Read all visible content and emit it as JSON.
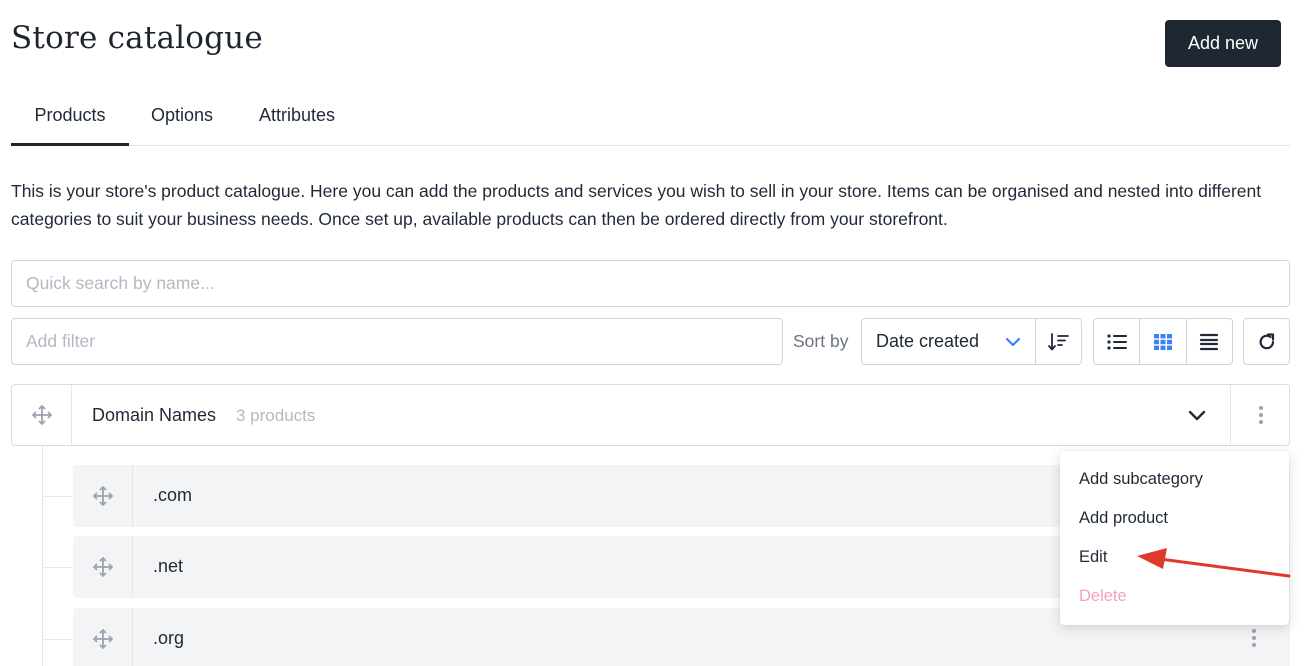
{
  "page": {
    "title": "Store catalogue",
    "add_new_label": "Add new"
  },
  "tabs": [
    {
      "label": "Products",
      "active": true
    },
    {
      "label": "Options",
      "active": false
    },
    {
      "label": "Attributes",
      "active": false
    }
  ],
  "description": "This is your store's product catalogue. Here you can add the products and services you wish to sell in your store. Items can be organised and nested into different categories to suit your business needs. Once set up, available products can then be ordered directly from your storefront.",
  "search": {
    "placeholder": "Quick search by name...",
    "value": ""
  },
  "filter": {
    "placeholder": "Add filter",
    "value": ""
  },
  "sort": {
    "label": "Sort by",
    "value": "Date created"
  },
  "category": {
    "name": "Domain Names",
    "count": "3 products"
  },
  "products": [
    {
      "name": ".com"
    },
    {
      "name": ".net"
    },
    {
      "name": ".org"
    }
  ],
  "context_menu": {
    "items": [
      {
        "label": "Add subcategory"
      },
      {
        "label": "Add product"
      },
      {
        "label": "Edit"
      },
      {
        "label": "Delete",
        "danger": true
      }
    ]
  },
  "colors": {
    "primary": "#1f2733",
    "accent": "#3b82f6",
    "danger": "#f2a5b6",
    "annotation_arrow": "#e0392b"
  },
  "icons": {
    "drag": "move-icon",
    "sort_chevron": "chevron-down-icon",
    "sort_direction": "sort-descending-icon",
    "view_list": "list-view-icon",
    "view_grid": "grid-view-icon",
    "view_compact": "compact-view-icon",
    "refresh": "refresh-icon",
    "expand": "chevron-down-icon",
    "menu": "vertical-dots-icon"
  }
}
